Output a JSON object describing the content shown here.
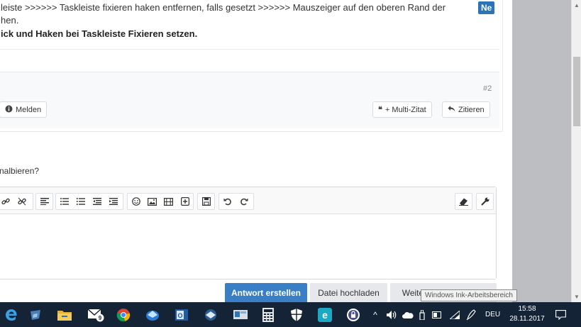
{
  "post": {
    "line1": "leiste >>>>>> Taskleiste fixieren haken entfernen, falls gesetzt >>>>>> Mauszeiger auf den oberen Rand der",
    "line2": "hen.",
    "line3": "ick und Haken bei Taskleiste Fixieren setzen.",
    "new_badge": "Ne",
    "number": "#2",
    "melden_label": "Melden",
    "multi_zitat_label": "+ Multi-Zitat",
    "zitieren_label": "Zitieren"
  },
  "question_text": "nalbieren?",
  "editor": {
    "toolbar_icons": [
      "link-icon",
      "unlink-icon",
      "align-left-icon",
      "bullet-list-icon",
      "numbered-list-icon",
      "outdent-icon",
      "indent-icon",
      "smiley-icon",
      "image-icon",
      "media-icon",
      "insert-icon",
      "save-draft-icon",
      "undo-icon",
      "redo-icon",
      "remove-format-icon",
      "tools-icon"
    ]
  },
  "actions": {
    "antwort_label": "Antwort erstellen",
    "datei_label": "Datei hochladen",
    "weitere_label": "Weitere Einstellungen"
  },
  "tooltip": "Windows Ink-Arbeitsbereich",
  "taskbar": {
    "apps": [
      "edge-icon",
      "store-icon",
      "file-explorer-icon",
      "mail-icon",
      "chrome-icon",
      "thunderbird-icon",
      "outlook-icon",
      "network-icon",
      "remote-desktop-icon",
      "calculator-icon",
      "defender-icon",
      "ie-icon",
      "keepass-icon"
    ],
    "mail_badge": "9",
    "language": "DEU",
    "time": "15:58",
    "date": "28.11.2017"
  },
  "colors": {
    "accent": "#3a7fc6",
    "taskbar": "#152336",
    "gray_side": "#bcbec1"
  }
}
